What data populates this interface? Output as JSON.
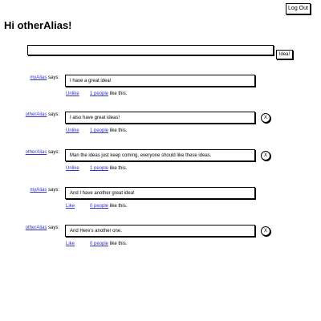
{
  "header": {
    "logout_label": "Log Out",
    "greeting": "Hi otherAlias!"
  },
  "composer": {
    "input_value": "",
    "submit_label": "Idea!"
  },
  "post_common": {
    "says_suffix": " says:",
    "likes_suffix": " like this.",
    "delete_symbol": "X"
  },
  "posts": [
    {
      "author": "myAlias",
      "text": "I have a great idea!",
      "like_action": "Unlike",
      "like_count": "1 people",
      "deletable": false
    },
    {
      "author": "otherAlias",
      "text": "I also have great ideas!",
      "like_action": "Unlike",
      "like_count": "1 people",
      "deletable": true
    },
    {
      "author": "otherAlias",
      "text": "Man the ideas just keep coming, everyone should like these ideas.",
      "like_action": "Unlike",
      "like_count": "1 people",
      "deletable": true
    },
    {
      "author": "myAlias",
      "text": "And I have another great idea!",
      "like_action": "Like",
      "like_count": "0 people",
      "deletable": false
    },
    {
      "author": "otherAlias",
      "text": "And Here's another one.",
      "like_action": "Like",
      "like_count": "0 people",
      "deletable": true
    }
  ]
}
